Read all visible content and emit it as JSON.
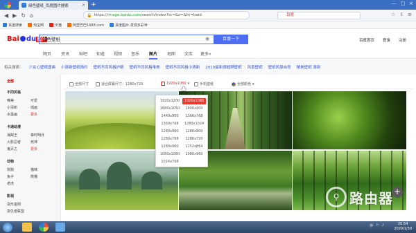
{
  "browser": {
    "tab_title": "绿色壁纸_百度图片搜索",
    "tab_close": "×",
    "new_tab": "+",
    "url_secure": "https://",
    "url_host": "image.baidu.com",
    "url_rest": "/search/index?ct=&z=&tn=baid",
    "search_placeholder": "百度",
    "window_controls": [
      "—",
      "□",
      "×"
    ]
  },
  "bookmarks": [
    {
      "label": "百度搜索",
      "color": "#2f7bd9"
    },
    {
      "label": "淘宝网",
      "color": "#ff6a00"
    },
    {
      "label": "天猫",
      "color": "#e2231a"
    },
    {
      "label": "阿里巴巴1688.com",
      "color": "#ff6a00"
    },
    {
      "label": "百度图片-发现多彩世",
      "color": "#2f7bd9"
    }
  ],
  "baidu": {
    "logo_bai": "Bai",
    "logo_du": "du",
    "logo_img": "图片",
    "query": "绿色壁纸",
    "search_button": "百度一下",
    "top_links": [
      "百度首页",
      "登录",
      "注册"
    ]
  },
  "nav_tabs": [
    {
      "label": "网页",
      "active": false
    },
    {
      "label": "资讯",
      "active": false
    },
    {
      "label": "贴吧",
      "active": false
    },
    {
      "label": "知道",
      "active": false
    },
    {
      "label": "视频",
      "active": false
    },
    {
      "label": "音乐",
      "active": false
    },
    {
      "label": "图片",
      "active": true
    },
    {
      "label": "地图",
      "active": false
    },
    {
      "label": "文库",
      "active": false
    },
    {
      "label": "更多»",
      "active": false
    }
  ],
  "related": {
    "label": "相关搜索：",
    "terms": [
      "少女心壁纸唐画",
      "小清新壁纸简约",
      "壁纸不同风格护眼",
      "壁纸不同风格唯美",
      "壁纸不同风格小清新",
      "2019最新颁超屏壁纸",
      "风景壁纸",
      "壁纸风景自然",
      "精美壁纸 清新"
    ]
  },
  "sidebar": {
    "sections": [
      {
        "title": "全部",
        "red": true,
        "items": []
      },
      {
        "title": "不同风格",
        "red": false,
        "items": [
          "唯美",
          "可爱",
          "小清新",
          "插画",
          "水墨画",
          "更多"
        ]
      },
      {
        "title": "卡通动漫",
        "red": false,
        "items": [
          "海贼王",
          "秦时明月",
          "火影忍者",
          "死神",
          "鬼灭之",
          "更多"
        ]
      },
      {
        "title": "动物",
        "red": false,
        "items": [
          "狗狗",
          "猫咪",
          "兔子",
          "熊猫",
          "老虎",
          ""
        ]
      },
      {
        "title": "影视",
        "red": false,
        "items": [
          "变形金刚",
          "",
          "复仇者联盟",
          ""
        ]
      }
    ]
  },
  "filters": [
    {
      "label": "全部尺寸",
      "active": false
    },
    {
      "label": "适合屏幕尺寸：1280x720",
      "active": false
    },
    {
      "label": "1920x1080",
      "active": true
    },
    {
      "label": "手机壁纸",
      "active": false
    },
    {
      "label": "全部颜色",
      "active": false
    }
  ],
  "resolutions": [
    [
      "1920x1200",
      "1920x1080"
    ],
    [
      "1680x1050",
      "1600x900"
    ],
    [
      "1440x900",
      "1366x768"
    ],
    [
      "1360x768",
      "1280x1024"
    ],
    [
      "1280x960",
      "1280x800"
    ],
    [
      "1280x768",
      "1280x720"
    ],
    [
      "1280x960",
      "1152x864"
    ],
    [
      "1080x1080",
      "1080x960"
    ],
    [
      "1024x768",
      ""
    ]
  ],
  "selected_resolution": "1920x1080",
  "images": [
    "绿色草原",
    "林荫大道",
    "绿叶特写",
    "青山田野",
    "林间溪流",
    "绿色森林"
  ],
  "watermark": {
    "text": "路由器",
    "symbol": "⚲"
  },
  "plus": "+",
  "taskbar": {
    "tray": [
      "中",
      "⚐",
      "♪"
    ],
    "time": "20:54",
    "date": "2020/1/30"
  }
}
